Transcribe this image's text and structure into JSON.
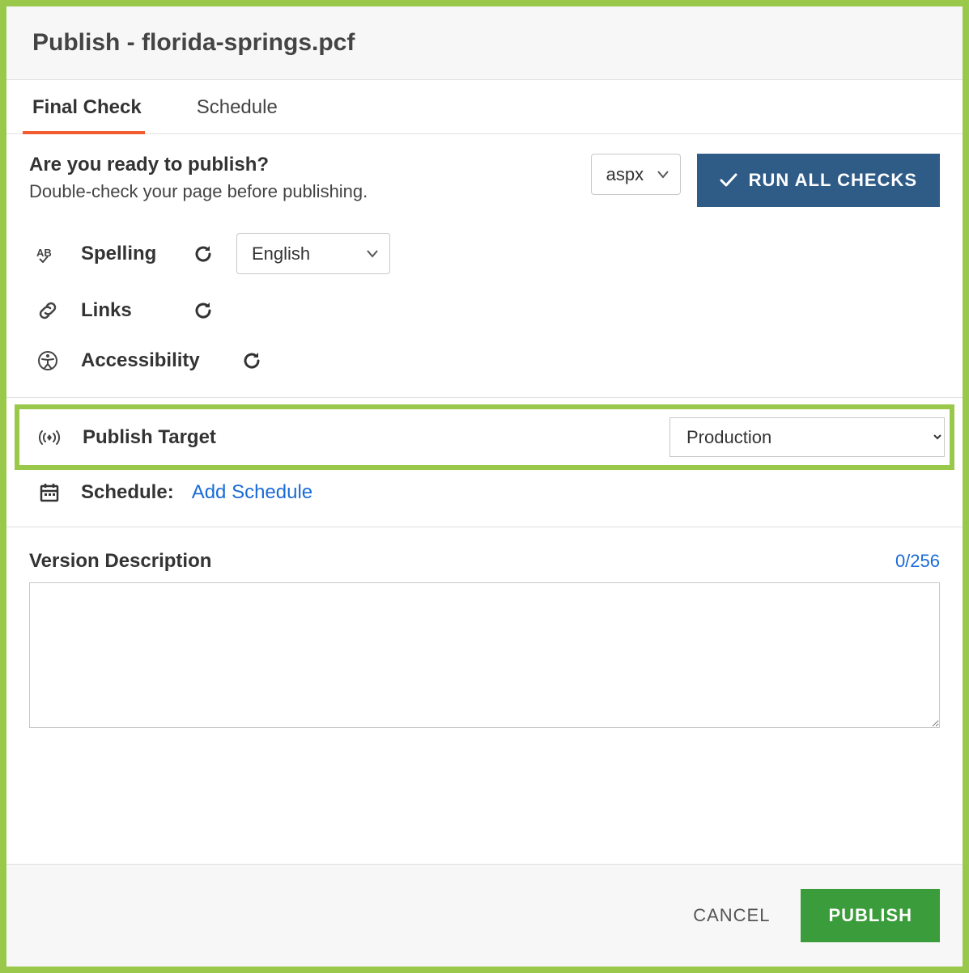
{
  "header": {
    "title": "Publish - florida-springs.pcf"
  },
  "tabs": {
    "final_check": "Final Check",
    "schedule": "Schedule"
  },
  "ready": {
    "heading": "Are you ready to publish?",
    "sub": "Double-check your page before publishing.",
    "format_selected": "aspx",
    "run_all_label": "RUN ALL CHECKS"
  },
  "checks": {
    "spelling_label": "Spelling",
    "spelling_lang_selected": "English",
    "links_label": "Links",
    "accessibility_label": "Accessibility"
  },
  "publish_target": {
    "label": "Publish Target",
    "selected": "Production"
  },
  "schedule_row": {
    "label": "Schedule:",
    "link": "Add Schedule"
  },
  "description": {
    "label": "Version Description",
    "counter": "0/256",
    "value": ""
  },
  "footer": {
    "cancel": "CANCEL",
    "publish": "PUBLISH"
  }
}
